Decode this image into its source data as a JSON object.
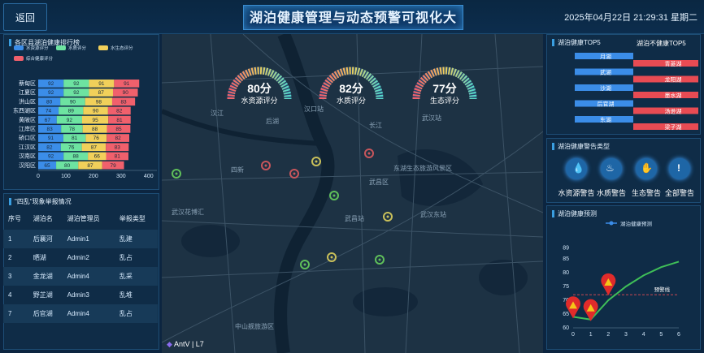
{
  "header": {
    "back_label": "返回",
    "title": "湖泊健康管理与动态预警可视化大屏",
    "datetime": "2025年04月22日 21:29:31 星期二"
  },
  "ranking": {
    "title": "各区县湖泊健康排行榜",
    "legend": [
      "水资源评分",
      "水质评分",
      "水生态评分",
      "综合健康评分"
    ],
    "colors": [
      "#3b8de8",
      "#6de3a1",
      "#f1d05a",
      "#f0606c"
    ],
    "chart_data": {
      "type": "bar",
      "categories": [
        "蔡甸区",
        "江夏区",
        "洪山区",
        "东西湖区",
        "黄陂区",
        "江岸区",
        "硚口区",
        "江汉区",
        "汉南区",
        "汉阳区"
      ],
      "series": [
        {
          "name": "水资源评分",
          "values": [
            92,
            92,
            80,
            74,
            67,
            83,
            91,
            82,
            92,
            65
          ]
        },
        {
          "name": "水质评分",
          "values": [
            92,
            92,
            90,
            89,
            92,
            78,
            81,
            76,
            88,
            80
          ]
        },
        {
          "name": "水生态评分",
          "values": [
            91,
            87,
            98,
            90,
            95,
            88,
            76,
            87,
            66,
            87
          ]
        },
        {
          "name": "综合健康评分",
          "values": [
            91,
            90,
            83,
            82,
            81,
            85,
            82,
            83,
            81,
            79
          ]
        }
      ],
      "xticks": [
        "0",
        "100",
        "200",
        "300",
        "400"
      ],
      "xlim": [
        0,
        400
      ]
    }
  },
  "reports": {
    "title": "\"四乱\"现象举报情况",
    "columns": [
      "序号",
      "湖泊名",
      "湖泊管理员",
      "举报类型"
    ],
    "rows": [
      [
        "1",
        "后襄河",
        "Admin1",
        "乱建"
      ],
      [
        "2",
        "晒湖",
        "Admin2",
        "乱占"
      ],
      [
        "3",
        "金龙湖",
        "Admin4",
        "乱采"
      ],
      [
        "4",
        "野芷湖",
        "Admin3",
        "乱堆"
      ],
      [
        "7",
        "后官湖",
        "Admin4",
        "乱占"
      ]
    ]
  },
  "gauges": [
    {
      "value": "80分",
      "label": "水资源评分"
    },
    {
      "value": "82分",
      "label": "水质评分"
    },
    {
      "value": "77分",
      "label": "生态评分"
    }
  ],
  "map": {
    "labels": [
      "汉口站",
      "武昌站",
      "武汉站",
      "东湖生态旅游风景区",
      "武汉东站",
      "武汉花博汇",
      "中山舰旅游区",
      "后湖",
      "四新",
      "汉江",
      "长江",
      "武昌区"
    ],
    "attribution": "AntV | L7"
  },
  "top5": {
    "title_healthy": "湖泊健康TOP5",
    "title_unhealthy": "湖泊不健康TOP5",
    "healthy": [
      "月湖",
      "武湖",
      "沙湖",
      "后官湖",
      "东湖"
    ],
    "unhealthy": [
      "青菱湖",
      "龙阳湖",
      "墨水湖",
      "汤逊湖",
      "梁子湖"
    ]
  },
  "warning_types": {
    "title": "湖泊健康警告类型",
    "items": [
      "水资源警告",
      "水质警告",
      "生态警告",
      "全部警告"
    ]
  },
  "forecast": {
    "title": "湖泊健康预测",
    "legend": "湖泊健康预测",
    "warning_line_label": "预警线",
    "chart_data": {
      "type": "line",
      "x": [
        0,
        1,
        2,
        3,
        4,
        5,
        6
      ],
      "series": [
        {
          "name": "湖泊健康预测",
          "values": [
            64,
            63,
            70,
            75,
            79,
            82,
            84
          ]
        }
      ],
      "warning_line": 72,
      "warnings_at": [
        0,
        1,
        2
      ],
      "ylim": [
        60,
        90
      ],
      "yticks": [
        60,
        65,
        70,
        75,
        80,
        85,
        89
      ]
    }
  }
}
